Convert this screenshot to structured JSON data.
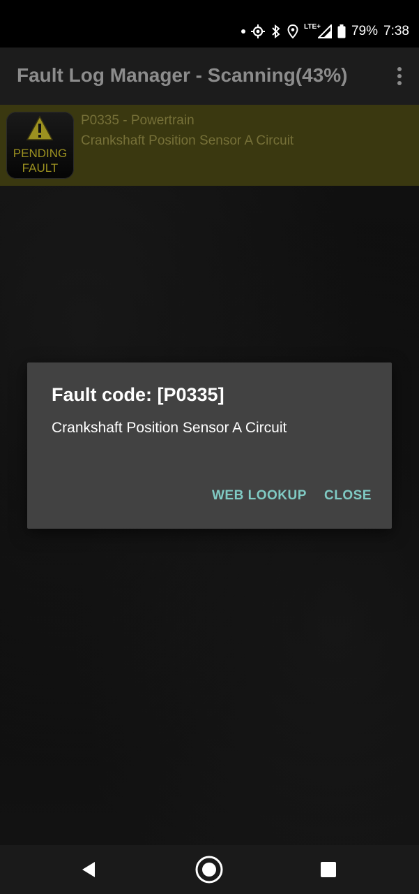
{
  "status_bar": {
    "battery": "79%",
    "time": "7:38",
    "network": "LTE+"
  },
  "app_bar": {
    "title": "Fault Log Manager - Scanning(43%)"
  },
  "fault_list": [
    {
      "badge_line1": "PENDING",
      "badge_line2": "FAULT",
      "code_line": "P0335 - Powertrain",
      "description": "Crankshaft Position Sensor A Circuit"
    }
  ],
  "dialog": {
    "title": "Fault code: [P0335]",
    "message": "Crankshaft Position Sensor A Circuit",
    "web_lookup_label": "WEB LOOKUP",
    "close_label": "CLOSE"
  },
  "colors": {
    "accent": "#80cbc4",
    "fault_row_bg": "#3a3810",
    "badge_text": "#9c9120",
    "dialog_bg": "#424242"
  },
  "icons": {
    "status": [
      "dot-icon",
      "gps-crosshair-icon",
      "bluetooth-icon",
      "location-icon",
      "signal-icon",
      "battery-icon"
    ],
    "nav": [
      "back-icon",
      "home-icon",
      "recents-icon"
    ]
  }
}
